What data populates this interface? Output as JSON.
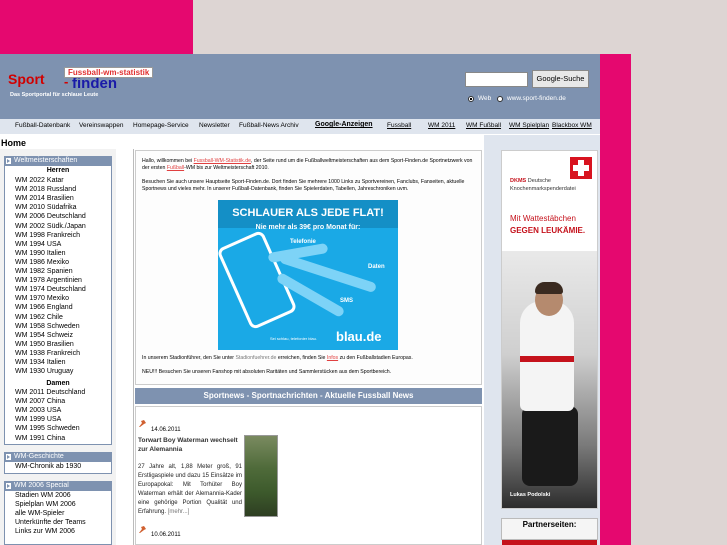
{
  "colors": {
    "brand_magenta": "#e5086f",
    "header_blue": "#7e92b0",
    "nav_light": "#dfe5ee",
    "link_red": "#e04040"
  },
  "logo": {
    "sport": "Sport",
    "dash": "-",
    "finden": "finden",
    "badge": "Fussball-wm-statistik",
    "tagline": "Das Sportportal für schlaue Leute"
  },
  "search": {
    "button": "Google-Suche",
    "value": "",
    "options": [
      "Web",
      "www.sport-finden.de"
    ]
  },
  "nav": [
    "Fußball-Datenbank",
    "Vereinswappen",
    "Homepage-Service",
    "Newsletter",
    "Fußball-News Archiv",
    "Google-Anzeigen",
    "Fussball",
    "WM 2011",
    "WM Fußball",
    "WM Spielplan",
    "Blackbox WM"
  ],
  "page_title": "Home",
  "left": {
    "panel1_title": "Weltmeisterschaften",
    "herren_title": "Herren",
    "herren": [
      "WM 2022 Katar",
      "WM 2018 Russland",
      "WM 2014 Brasilien",
      "WM 2010 Südafrika",
      "WM 2006 Deutschland",
      "WM 2002 Südk./Japan",
      "WM 1998 Frankreich",
      "WM 1994 USA",
      "WM 1990 Italien",
      "WM 1986 Mexiko",
      "WM 1982 Spanien",
      "WM 1978 Argentinien",
      "WM 1974 Deutschland",
      "WM 1970 Mexiko",
      "WM 1966 England",
      "WM 1962 Chile",
      "WM 1958 Schweden",
      "WM 1954 Schweiz",
      "WM 1950 Brasilien",
      "WM 1938 Frankreich",
      "WM 1934 Italien",
      "WM 1930 Uruguay"
    ],
    "damen_title": "Damen",
    "damen": [
      "WM 2011 Deutschland",
      "WM 2007 China",
      "WM 2003 USA",
      "WM 1999 USA",
      "WM 1995 Schweden",
      "WM 1991 China"
    ],
    "panel2_title": "WM-Geschichte",
    "geschichte": [
      "WM-Chronik ab 1930"
    ],
    "panel3_title": "WM 2006 Special",
    "special": [
      "Stadien WM 2006",
      "Spielplan WM 2006",
      "alle WM-Spieler",
      "Unterkünfte der Teams",
      "Links zur WM 2006"
    ]
  },
  "welcome": {
    "p1_a": "Hallo, willkommen bei ",
    "p1_link1": "Fussball-WM-Statistik.de",
    "p1_b": ", der Seite rund um die Fußballweltmeisterschaften aus dem Sport-Finden.de Sportnetzwerk von der ersten ",
    "p1_link2": "Fußball",
    "p1_c": "-WM bis zur Weltmeisterschaft 2010.",
    "p2": "Besuchen Sie auch unsere Hauptseite Sport-Finden.de. Dort finden Sie mehrere 1000 Links zu Sportvereinen, Fanclubs, Fanseiten, aktuelle Sportnews und vieles mehr. In unserer Fußball-Datenbank, finden Sie Spielerdaten, Tabellen, Jahreschroniken uvm.",
    "p3_a": "In unserem Stadionführer, den Sie unter ",
    "p3_link": "Stadionfuehrer.de",
    "p3_b": " erreichen, finden Sie ",
    "p3_link2": "Infos",
    "p3_c": " zu den Fußballstadien Europas.",
    "p4": "NEU!!! Besuchen Sie unseren Fanshop mit absoluten Raritäten und Sammlerstücken aus dem Sportbereich."
  },
  "ad": {
    "title": "SCHLAUER ALS JEDE FLAT!",
    "sub": "Nie mehr als 39€ pro Monat für:",
    "labels": [
      "Telefonie",
      "Daten",
      "SMS"
    ],
    "small": "Sei schlau, telefonier blau.",
    "brand": "blau.de"
  },
  "news": {
    "bar": "Sportnews - Sportnachrichten - Aktuelle Fussball News",
    "items": [
      {
        "date": "14.06.2011",
        "title": "Torwart Boy Waterman wechselt zur Alemannia",
        "body": "27 Jahre alt, 1,88 Meter groß, 91 Erstligaspiele und dazu 15 Einsätze im Europapokal: Mit Torhüter Boy Waterman erhält der Alemannia-Kader eine gehörige Portion Qualität und Erfahrung.",
        "more": "[mehr...]"
      },
      {
        "date": "10.06.2011",
        "title": "",
        "body": ""
      }
    ]
  },
  "dkms": {
    "name_line1": "Deutsche",
    "name_line2": "Knochenmarkspenderdatei",
    "logo_text": "DKMS",
    "slogan_line1": "Mit Wattestäbchen",
    "slogan_line2": "GEGEN LEUKÄMIE.",
    "caption": "Lukas Podolski"
  },
  "partner": {
    "title": "Partnerseiten:"
  }
}
